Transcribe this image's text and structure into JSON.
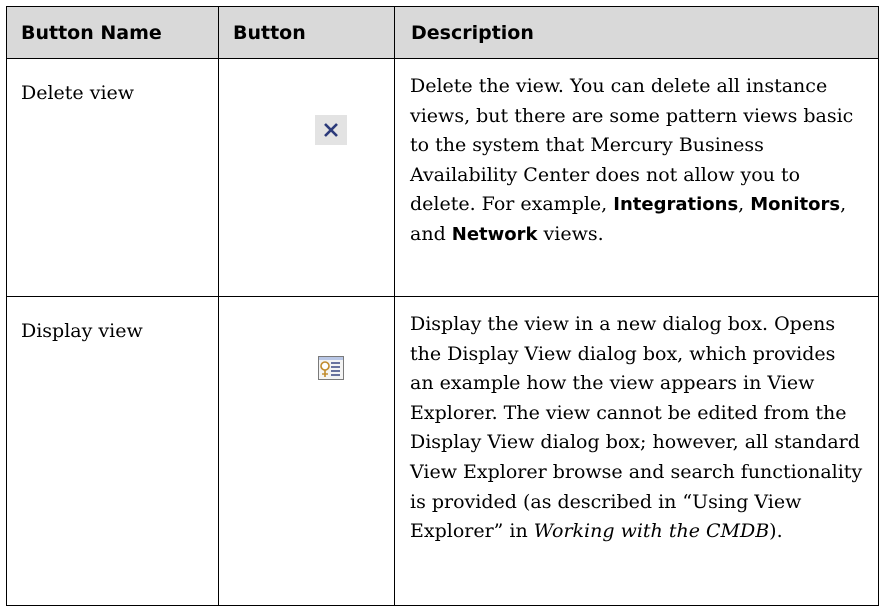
{
  "table": {
    "headers": {
      "name": "Button Name",
      "button": "Button",
      "description": "Description"
    },
    "rows": [
      {
        "name": "Delete view",
        "icon": "delete-x-icon",
        "description": {
          "text1": "Delete the view. You can delete all instance views, but there are some pattern views basic to the system that Mercury Business Availability Center does not allow you to delete. For example, ",
          "bold1": "Integrations",
          "sep1": ", ",
          "bold2": "Monitors",
          "sep2": ", and ",
          "bold3": "Network",
          "text2": " views."
        }
      },
      {
        "name": "Display view",
        "icon": "display-view-icon",
        "description": {
          "text1": "Display the view in a new dialog box. Opens the Display View dialog box, which provides an example how the view appears in View Explorer. The view cannot be edited from the Display View dialog box; however, all standard View Explorer browse and search functionality is provided (as described in “Using View Explorer” in ",
          "italic1": "Working with the CMDB",
          "text2": ")."
        }
      }
    ]
  },
  "colors": {
    "header_bg": "#d9d9d9",
    "icon_bg": "#e3e3e3",
    "icon_x": "#2b3a7a"
  }
}
